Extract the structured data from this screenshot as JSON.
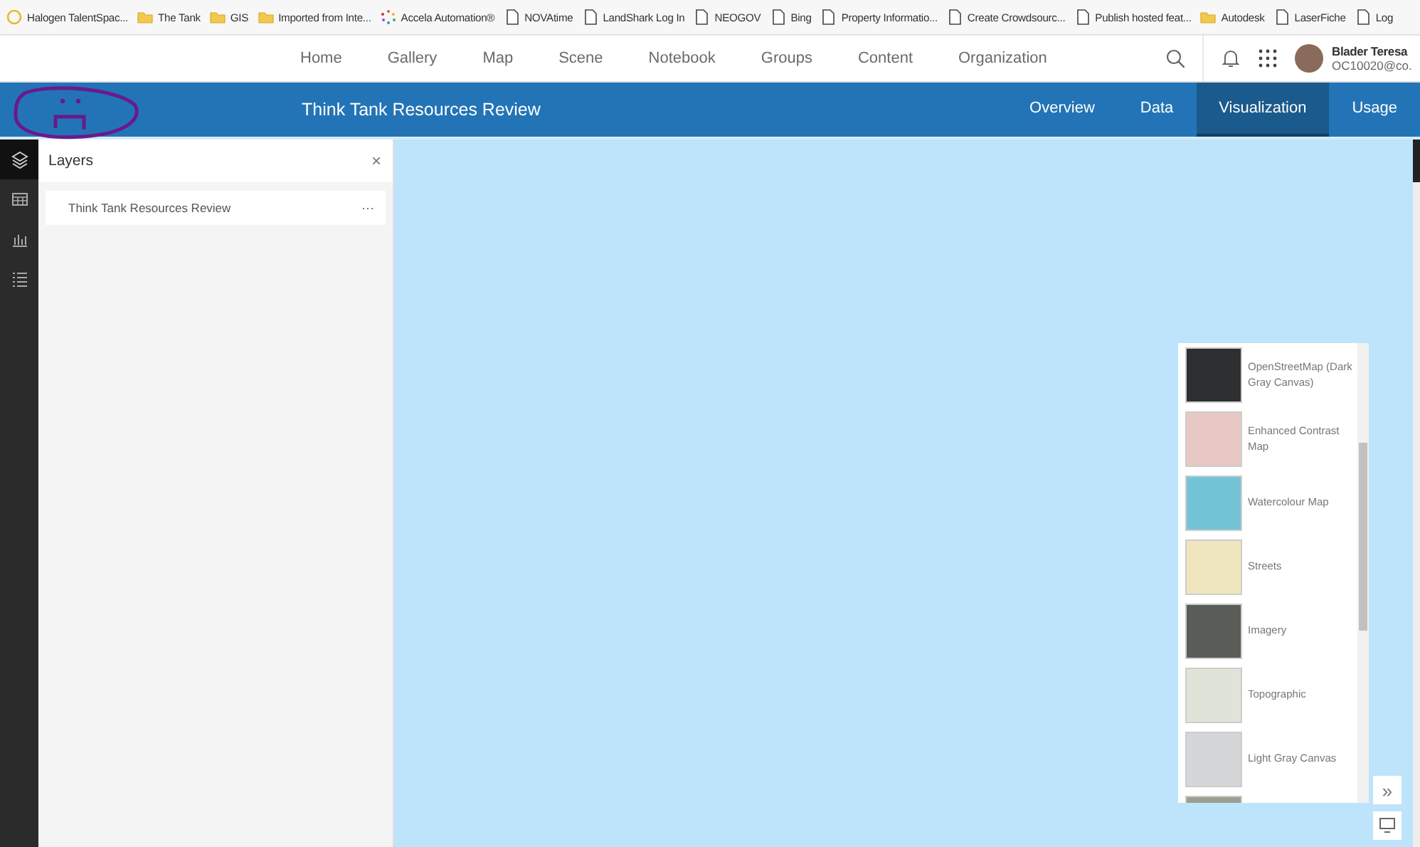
{
  "bookmarks": [
    {
      "kind": "ring",
      "label": "Halogen TalentSpac..."
    },
    {
      "kind": "folder",
      "label": "The Tank"
    },
    {
      "kind": "folder",
      "label": "GIS"
    },
    {
      "kind": "folder",
      "label": "Imported from Inte..."
    },
    {
      "kind": "dots",
      "label": "Accela Automation®"
    },
    {
      "kind": "page",
      "label": "NOVAtime"
    },
    {
      "kind": "page",
      "label": "LandShark  Log In"
    },
    {
      "kind": "page",
      "label": "NEOGOV"
    },
    {
      "kind": "page",
      "label": "Bing"
    },
    {
      "kind": "page",
      "label": "Property Informatio..."
    },
    {
      "kind": "page",
      "label": "Create Crowdsourc..."
    },
    {
      "kind": "page",
      "label": "Publish hosted feat..."
    },
    {
      "kind": "folder",
      "label": "Autodesk"
    },
    {
      "kind": "page",
      "label": "LaserFiche"
    },
    {
      "kind": "page",
      "label": "Log"
    }
  ],
  "top_nav": {
    "items": [
      "Home",
      "Gallery",
      "Map",
      "Scene",
      "Notebook",
      "Groups",
      "Content",
      "Organization"
    ],
    "user": {
      "name": "Blader Teresa",
      "account": "OC10020@co."
    }
  },
  "header": {
    "title": "Think Tank Resources Review",
    "tabs": [
      {
        "label": "Overview",
        "selected": false
      },
      {
        "label": "Data",
        "selected": false
      },
      {
        "label": "Visualization",
        "selected": true
      },
      {
        "label": "Usage",
        "selected": false
      }
    ]
  },
  "side_toolbar": [
    {
      "kind": "layers",
      "selected": true
    },
    {
      "kind": "table",
      "selected": false
    },
    {
      "kind": "chart",
      "selected": false
    },
    {
      "kind": "list",
      "selected": false
    }
  ],
  "layers_panel": {
    "title": "Layers",
    "close": "×",
    "layers": [
      {
        "name": "Think Tank Resources Review",
        "menu": "···"
      }
    ]
  },
  "basemap_gallery": [
    {
      "kind": "option",
      "label": "OpenStreetMap (Dark Gray Canvas)"
    },
    {
      "kind": "option",
      "label": "Enhanced Contrast Map"
    },
    {
      "kind": "option",
      "label": "Watercolour Map"
    },
    {
      "kind": "option",
      "label": "Streets"
    },
    {
      "kind": "option",
      "label": "Imagery"
    },
    {
      "kind": "option",
      "label": "Topographic"
    },
    {
      "kind": "option",
      "label": "Light Gray Canvas"
    },
    {
      "kind": "cut_off"
    }
  ],
  "map_buttons": {
    "expand": "»"
  }
}
